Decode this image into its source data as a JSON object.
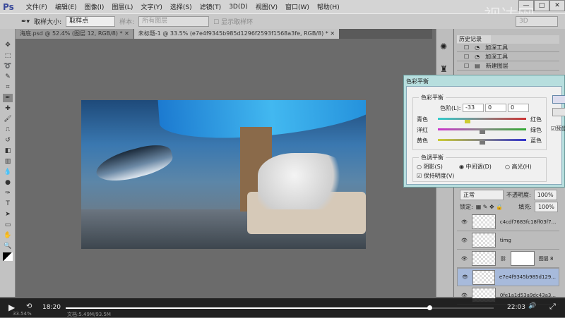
{
  "app": {
    "logo": "Ps",
    "watermark": "视达网"
  },
  "menu": [
    "文件(F)",
    "编辑(E)",
    "图像(I)",
    "图层(L)",
    "文字(Y)",
    "选择(S)",
    "滤镜(T)",
    "3D(D)",
    "视图(V)",
    "窗口(W)",
    "帮助(H)"
  ],
  "options": {
    "sample_size_label": "取样大小:",
    "sample_size_value": "取样点",
    "sample_label": "样本:",
    "sample_value": "所有图层",
    "show_ring": "显示取样环",
    "workspace": "3D"
  },
  "tabs": [
    {
      "label": "海底.psd @ 52.4% (图层 12, RGB/8) *",
      "active": false
    },
    {
      "label": "未标题-1 @ 33.5% (e7e4f9345b985d1296f2593f1568a3fe, RGB/8) *",
      "active": true
    }
  ],
  "history": {
    "title": "历史记录",
    "items": [
      "加深工具",
      "加深工具",
      "新建图层"
    ]
  },
  "dialog": {
    "title": "色彩平衡",
    "group1": "色彩平衡",
    "levels_label": "色阶(L):",
    "levels": [
      "-33",
      "0",
      "0"
    ],
    "sliders": [
      {
        "left": "青色",
        "right": "红色",
        "value": -33
      },
      {
        "left": "洋红",
        "right": "绿色",
        "value": 0
      },
      {
        "left": "黄色",
        "right": "蓝色",
        "value": 0
      }
    ],
    "group2": "色调平衡",
    "tones": [
      "阴影(S)",
      "中间调(D)",
      "高光(H)"
    ],
    "selected_tone": "中间调(D)",
    "preserve": "保持明度(V)",
    "preview": "预览"
  },
  "layers": {
    "kind": "类型",
    "blend": "正常",
    "opacity_label": "不透明度:",
    "opacity": "100%",
    "lock_label": "锁定:",
    "fill_label": "填充:",
    "fill": "100%",
    "items": [
      {
        "name": "c4cdf7683fc18ff03f7...",
        "selected": false
      },
      {
        "name": "timg",
        "selected": false
      },
      {
        "name": "图层 8",
        "selected": false
      },
      {
        "name": "e7e4f9345b985d129...",
        "selected": true
      },
      {
        "name": "0fe1a1d53a9dc43a3...",
        "selected": false
      }
    ]
  },
  "video": {
    "current": "18:20",
    "total": "22:03",
    "progress": 0.85,
    "status": "33.54%",
    "doc": "文档:5.49M/93.5M"
  }
}
